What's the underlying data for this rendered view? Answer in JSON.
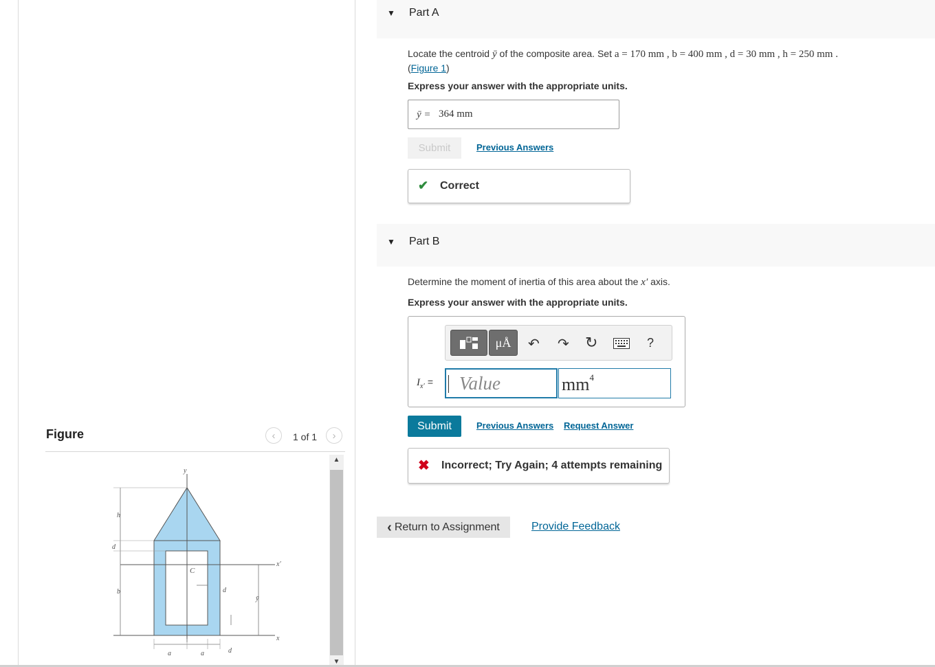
{
  "figure": {
    "title": "Figure",
    "counter": "1 of 1",
    "diagram_labels": {
      "y_axis": "y",
      "x_axis": "x",
      "x_prime_axis": "x′",
      "centroid": "C",
      "h": "h",
      "d_top": "d",
      "b": "b",
      "d_right": "d",
      "y_bar": "ȳ",
      "a_left": "a",
      "a_right": "a",
      "d_bottom": "d"
    }
  },
  "partA": {
    "title": "Part A",
    "question_prefix": "Locate the centroid",
    "question_symbol": "ȳ",
    "question_mid": "of the composite area. Set",
    "params": "a = 170 mm , b = 400 mm , d = 30 mm , h = 250 mm .",
    "figure_link_open": "(",
    "figure_link": "Figure 1",
    "figure_link_close": ")",
    "instruction": "Express your answer with the appropriate units.",
    "answer_label": "ȳ =",
    "answer_value": "364 mm",
    "submit_label": "Submit",
    "previous_answers": "Previous Answers",
    "result": "Correct"
  },
  "partB": {
    "title": "Part B",
    "question_prefix": "Determine the moment of inertia of this area about the",
    "question_symbol": "x′",
    "question_suffix": "axis.",
    "instruction": "Express your answer with the appropriate units.",
    "toolbar": {
      "units_symbol": "μÅ",
      "help": "?"
    },
    "input_label_main": "I",
    "input_label_sub": "x′",
    "input_label_eq": "=",
    "value_placeholder": "Value",
    "unit_base": "mm",
    "unit_exp": "4",
    "submit_label": "Submit",
    "previous_answers": "Previous Answers",
    "request_answer": "Request Answer",
    "result": "Incorrect; Try Again; 4 attempts remaining"
  },
  "footer": {
    "return_label": "Return to Assignment",
    "feedback_label": "Provide Feedback"
  },
  "colors": {
    "shape_fill": "#a9d6f0",
    "link": "#006596",
    "submit_active": "#0b7a9c",
    "correct": "#2e8b3d",
    "incorrect": "#d0021b"
  }
}
